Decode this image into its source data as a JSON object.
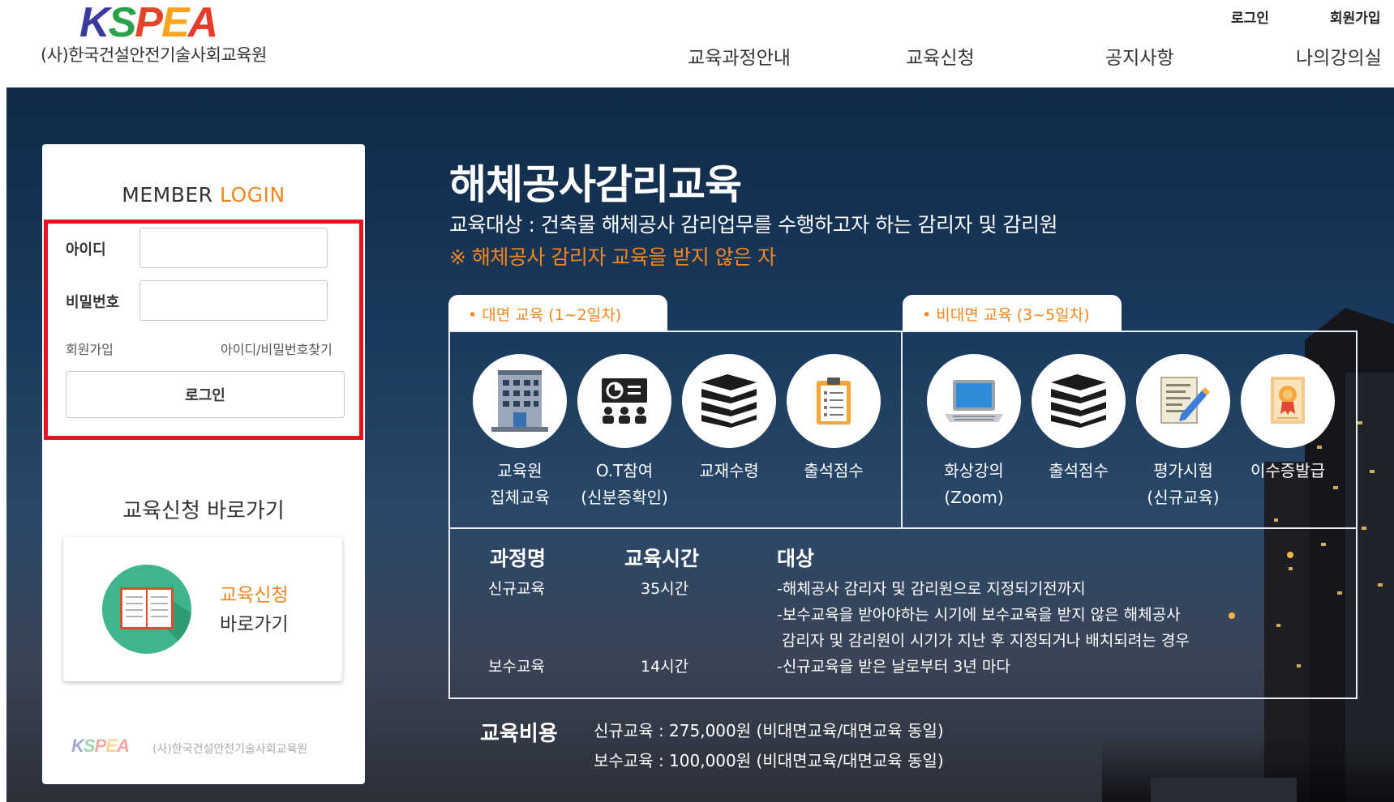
{
  "header": {
    "logo_text": "KSPEA",
    "org_name": "(사)한국건설안전기술사회교육원",
    "util_links": [
      "로그인",
      "회원가입"
    ],
    "nav": [
      "교육과정안내",
      "교육신청",
      "공지사항",
      "나의강의실"
    ]
  },
  "login_panel": {
    "title_part1": "MEMBER",
    "title_part2": "LOGIN",
    "id_label": "아이디",
    "id_value": "",
    "pw_label": "비밀번호",
    "pw_value": "",
    "signup_link": "회원가입",
    "find_link": "아이디/비밀번호찾기",
    "login_button": "로그인",
    "quick_title": "교육신청 바로가기",
    "quick_card_line1": "교육신청",
    "quick_card_line2": "바로가기",
    "footer_logo": "KSPEA",
    "footer_org": "(사)한국건설안전기술사회교육원"
  },
  "main": {
    "title": "해체공사감리교육",
    "target": "교육대상 : 건축물 해체공사 감리업무를 수행하고자 하는 감리자 및 감리원",
    "note": "※ 해체공사 감리자 교육을 받지 않은 자",
    "tab_inperson": "• 대면 교육 (1~2일차)",
    "tab_online": "• 비대면 교육 (3~5일차)",
    "steps_inperson": [
      {
        "line1": "교육원",
        "line2": "집체교육",
        "icon": "building-icon"
      },
      {
        "line1": "O.T참여",
        "line2": "(신분증확인)",
        "icon": "presentation-icon"
      },
      {
        "line1": "교재수령",
        "line2": "",
        "icon": "books-icon"
      },
      {
        "line1": "출석점수",
        "line2": "",
        "icon": "clipboard-icon"
      }
    ],
    "steps_online": [
      {
        "line1": "화상강의",
        "line2": "(Zoom)",
        "icon": "laptop-icon"
      },
      {
        "line1": "출석점수",
        "line2": "",
        "icon": "books-icon"
      },
      {
        "line1": "평가시험",
        "line2": "(신규교육)",
        "icon": "exam-icon"
      },
      {
        "line1": "이수증발급",
        "line2": "",
        "icon": "certificate-icon"
      }
    ],
    "table": {
      "headers": [
        "과정명",
        "교육시간",
        "대상"
      ],
      "rows": [
        {
          "course": "신규교육",
          "hours": "35시간",
          "target": "-해체공사 감리자 및 감리원으로 지정되기전까지"
        },
        {
          "course": "",
          "hours": "",
          "target": "-보수교육을 받아야하는 시기에 보수교육을 받지 않은 해체공사"
        },
        {
          "course": "",
          "hours": "",
          "target": " 감리자 및 감리원이 시기가 지난 후 지정되거나 배치되려는 경우"
        },
        {
          "course": "보수교육",
          "hours": "14시간",
          "target": "-신규교육을 받은 날로부터 3년 마다"
        }
      ]
    },
    "fee_label": "교육비용",
    "fee_lines": [
      "신규교육 : 275,000원 (비대면교육/대면교육 동일)",
      "보수교육 : 100,000원 (비대면교육/대면교육 동일)"
    ]
  },
  "colors": {
    "accent_orange": "#f2861f",
    "highlight_red": "#e3131f",
    "hero_navy": "#1a3a5d",
    "icon_green": "#3fb58b"
  }
}
